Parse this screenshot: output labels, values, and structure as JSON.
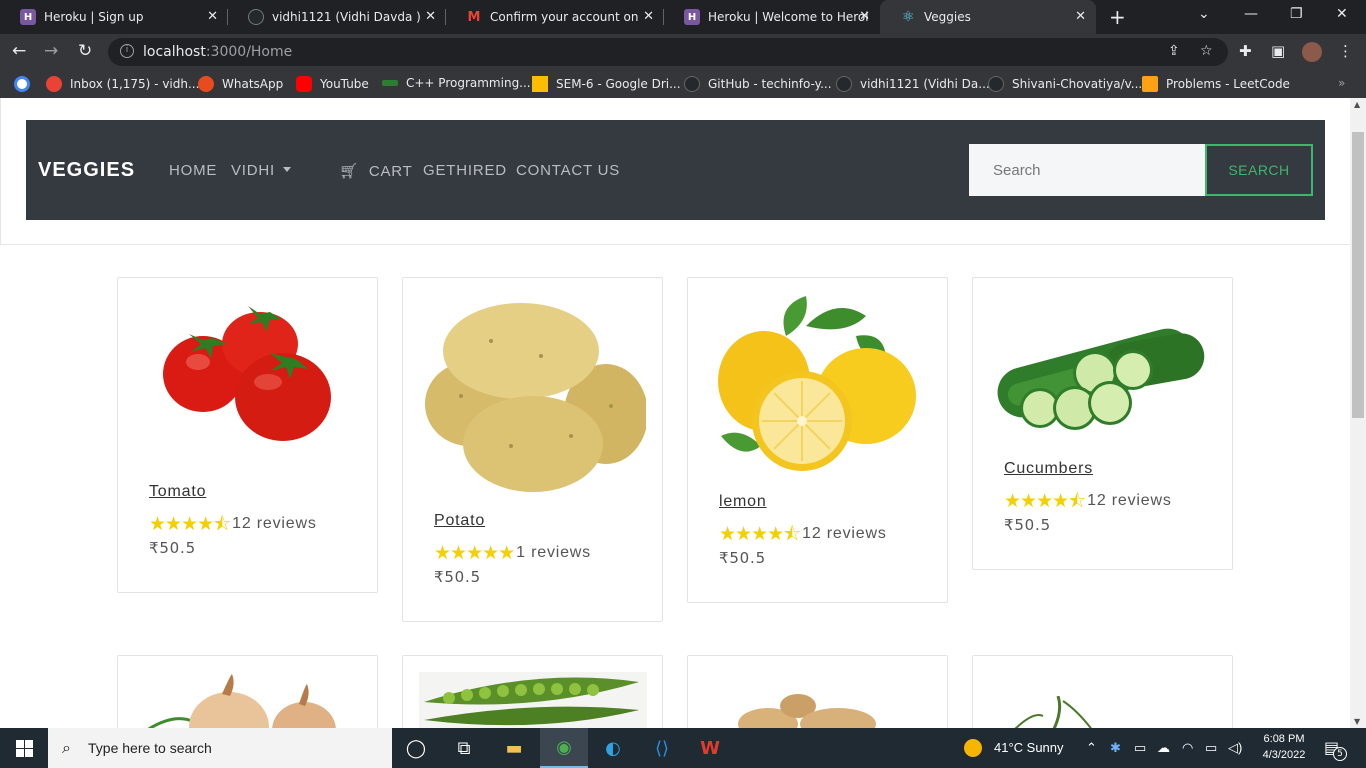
{
  "browser": {
    "tabs": [
      {
        "title": "Heroku | Sign up",
        "favicon": "heroku-icon",
        "color": "#79589f"
      },
      {
        "title": "vidhi1121 (Vidhi Davda )",
        "favicon": "github-icon",
        "color": "#24292e"
      },
      {
        "title": "Confirm your account on Her",
        "favicon": "gmail-icon",
        "color": "#ea4335"
      },
      {
        "title": "Heroku | Welcome to Heroku",
        "favicon": "heroku-icon",
        "color": "#79589f"
      },
      {
        "title": "Veggies",
        "favicon": "react-icon",
        "color": "#61dafb",
        "active": true
      }
    ],
    "url_host": "localhost",
    "url_path": ":3000/Home",
    "bookmarks": [
      {
        "label": "Inbox (1,175) - vidh...",
        "icon": "gmail-icon",
        "color": "#ea4335"
      },
      {
        "label": "WhatsApp",
        "icon": "whatsapp-icon",
        "color": "#e84c1e"
      },
      {
        "label": "YouTube",
        "icon": "youtube-icon",
        "color": "#ff0000"
      },
      {
        "label": "C++ Programming...",
        "icon": "cpp-icon",
        "color": "#2e7d32"
      },
      {
        "label": "SEM-6 - Google Dri...",
        "icon": "drive-icon",
        "color": "#fbbc04"
      },
      {
        "label": "GitHub - techinfo-y...",
        "icon": "github-icon",
        "color": "#24292e"
      },
      {
        "label": "vidhi1121 (Vidhi Da...",
        "icon": "github-icon",
        "color": "#24292e"
      },
      {
        "label": "Shivani-Chovatiya/v...",
        "icon": "github-icon",
        "color": "#24292e"
      },
      {
        "label": "Problems - LeetCode",
        "icon": "leetcode-icon",
        "color": "#ffa116"
      }
    ]
  },
  "navbar": {
    "brand": "VEGGIES",
    "links": {
      "home": "HOME",
      "vidhi": "VIDHI",
      "cart": "CART",
      "gethired": "GETHIRED",
      "contact": "CONTACT US"
    },
    "search_placeholder": "Search",
    "search_button": "SEARCH",
    "accent_color": "#3fb56d"
  },
  "products": [
    {
      "name": "Tomato",
      "rating": "4.5",
      "stars": "★★★★⯪",
      "reviews": "12 reviews",
      "price": "₹50.5"
    },
    {
      "name": "Potato",
      "rating": "5",
      "stars": "★★★★★",
      "reviews": "1 reviews",
      "price": "₹50.5"
    },
    {
      "name": "lemon",
      "rating": "4.5",
      "stars": "★★★★⯪",
      "reviews": "12 reviews",
      "price": "₹50.5"
    },
    {
      "name": "Cucumbers",
      "rating": "4.5",
      "stars": "★★★★⯪",
      "reviews": "12 reviews",
      "price": "₹50.5"
    }
  ],
  "taskbar": {
    "search_placeholder": "Type here to search",
    "weather": "41°C  Sunny",
    "time": "6:08 PM",
    "date": "4/3/2022",
    "notifications": "5"
  }
}
